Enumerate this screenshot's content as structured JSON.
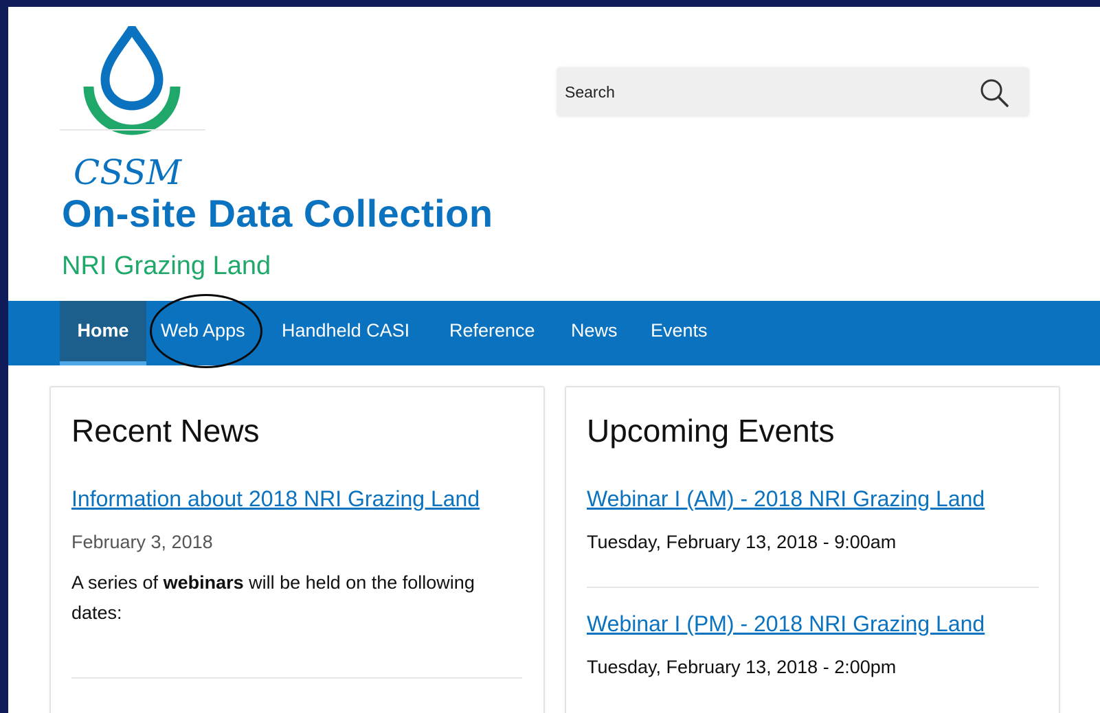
{
  "colors": {
    "brand_blue": "#0a72be",
    "brand_green": "#1fa869",
    "nav_active": "#1c5f8c",
    "frame_bg": "#101c5a"
  },
  "header": {
    "logo_text": "CSSM",
    "site_name": "On-site Data Collection",
    "site_slogan": "NRI Grazing Land"
  },
  "search": {
    "placeholder": "Search",
    "icon": "search-icon"
  },
  "nav": {
    "items": [
      {
        "label": "Home",
        "active": true
      },
      {
        "label": "Web Apps",
        "active": false,
        "highlighted": true
      },
      {
        "label": "Handheld CASI",
        "active": false
      },
      {
        "label": "Reference",
        "active": false
      },
      {
        "label": "News",
        "active": false
      },
      {
        "label": "Events",
        "active": false
      }
    ]
  },
  "recent_news": {
    "title": "Recent News",
    "items": [
      {
        "link": "Information about 2018 NRI Grazing Land",
        "date": "February 3, 2018",
        "summary_pre": "A series of ",
        "summary_bold": "webinars",
        "summary_post": " will be held on the following dates:"
      }
    ]
  },
  "upcoming_events": {
    "title": "Upcoming Events",
    "items": [
      {
        "link": "Webinar I (AM) - 2018 NRI Grazing Land",
        "date": "Tuesday, February 13, 2018 - 9:00am"
      },
      {
        "link": "Webinar I (PM) - 2018 NRI Grazing Land",
        "date": "Tuesday, February 13, 2018 - 2:00pm"
      }
    ]
  }
}
